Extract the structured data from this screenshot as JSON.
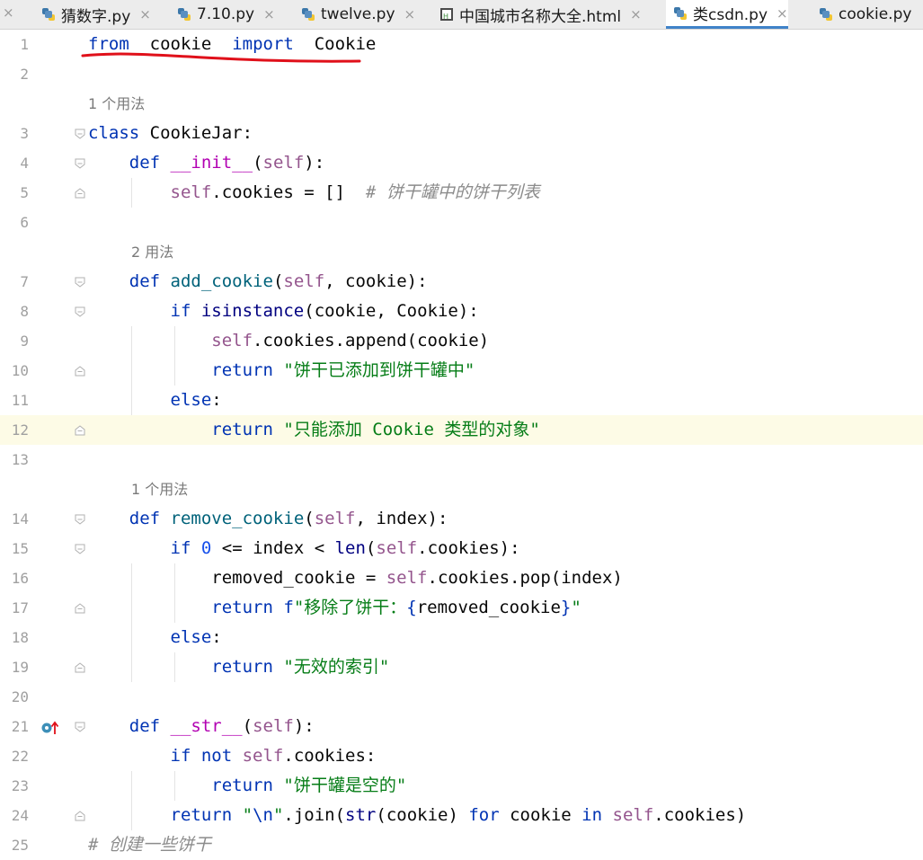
{
  "tabs": [
    {
      "label": "猜数字.py",
      "type": "py",
      "active": false
    },
    {
      "label": "7.10.py",
      "type": "py",
      "active": false
    },
    {
      "label": "twelve.py",
      "type": "py",
      "active": false
    },
    {
      "label": "中国城市名称大全.html",
      "type": "html",
      "active": false
    },
    {
      "label": "类csdn.py",
      "type": "py",
      "active": true
    },
    {
      "label": "cookie.py",
      "type": "py",
      "active": false
    }
  ],
  "close_glyph": "×",
  "usage_hints": {
    "h1": "1 个用法",
    "h2": "2 用法",
    "h3": "1 个用法"
  },
  "lines": [
    {
      "n": "1",
      "tokens": [
        [
          "kw",
          "from"
        ],
        [
          "",
          "  "
        ],
        [
          "",
          "cookie"
        ],
        [
          "",
          "  "
        ],
        [
          "kw",
          "import"
        ],
        [
          "",
          "  "
        ],
        [
          "",
          "Cookie"
        ]
      ]
    },
    {
      "n": "2",
      "tokens": []
    },
    {
      "n": "3",
      "tokens": [
        [
          "kw",
          "class"
        ],
        [
          "",
          " CookieJar:"
        ]
      ]
    },
    {
      "n": "4",
      "tokens": [
        [
          "",
          "    "
        ],
        [
          "kw",
          "def"
        ],
        [
          "",
          " "
        ],
        [
          "dunder",
          "__init__"
        ],
        [
          "",
          "("
        ],
        [
          "self",
          "self"
        ],
        [
          "",
          "):"
        ]
      ]
    },
    {
      "n": "5",
      "tokens": [
        [
          "",
          "        "
        ],
        [
          "self",
          "self"
        ],
        [
          "",
          ".cookies = []  "
        ],
        [
          "cmt",
          "# 饼干罐中的饼干列表"
        ]
      ]
    },
    {
      "n": "6",
      "tokens": []
    },
    {
      "n": "7",
      "tokens": [
        [
          "",
          "    "
        ],
        [
          "kw",
          "def"
        ],
        [
          "",
          " "
        ],
        [
          "fn",
          "add_cookie"
        ],
        [
          "",
          "("
        ],
        [
          "self",
          "self"
        ],
        [
          "",
          ", cookie):"
        ]
      ]
    },
    {
      "n": "8",
      "tokens": [
        [
          "",
          "        "
        ],
        [
          "kw",
          "if"
        ],
        [
          "",
          " "
        ],
        [
          "blt",
          "isinstance"
        ],
        [
          "",
          "(cookie, Cookie):"
        ]
      ]
    },
    {
      "n": "9",
      "tokens": [
        [
          "",
          "            "
        ],
        [
          "self",
          "self"
        ],
        [
          "",
          ".cookies.append(cookie)"
        ]
      ]
    },
    {
      "n": "10",
      "tokens": [
        [
          "",
          "            "
        ],
        [
          "kw",
          "return"
        ],
        [
          "",
          " "
        ],
        [
          "str",
          "\"饼干已添加到饼干罐中\""
        ]
      ]
    },
    {
      "n": "11",
      "tokens": [
        [
          "",
          "        "
        ],
        [
          "kw",
          "else"
        ],
        [
          "",
          ":"
        ]
      ]
    },
    {
      "n": "12",
      "tokens": [
        [
          "",
          "            "
        ],
        [
          "kw",
          "return"
        ],
        [
          "",
          " "
        ],
        [
          "str",
          "\"只能添加 Cookie 类型的对象\""
        ]
      ]
    },
    {
      "n": "13",
      "tokens": []
    },
    {
      "n": "14",
      "tokens": [
        [
          "",
          "    "
        ],
        [
          "kw",
          "def"
        ],
        [
          "",
          " "
        ],
        [
          "fn",
          "remove_cookie"
        ],
        [
          "",
          "("
        ],
        [
          "self",
          "self"
        ],
        [
          "",
          ", index):"
        ]
      ]
    },
    {
      "n": "15",
      "tokens": [
        [
          "",
          "        "
        ],
        [
          "kw",
          "if"
        ],
        [
          "",
          " "
        ],
        [
          "num",
          "0"
        ],
        [
          "",
          " <= index < "
        ],
        [
          "blt",
          "len"
        ],
        [
          "",
          "("
        ],
        [
          "self",
          "self"
        ],
        [
          "",
          ".cookies):"
        ]
      ]
    },
    {
      "n": "16",
      "tokens": [
        [
          "",
          "            removed_cookie = "
        ],
        [
          "self",
          "self"
        ],
        [
          "",
          ".cookies.pop(index)"
        ]
      ]
    },
    {
      "n": "17",
      "tokens": [
        [
          "",
          "            "
        ],
        [
          "kw",
          "return"
        ],
        [
          "",
          " "
        ],
        [
          "kw",
          "f"
        ],
        [
          "str",
          "\"移除了饼干："
        ],
        [
          "kw",
          "{"
        ],
        [
          "",
          "removed_cookie"
        ],
        [
          "kw",
          "}"
        ],
        [
          "str",
          "\""
        ]
      ]
    },
    {
      "n": "18",
      "tokens": [
        [
          "",
          "        "
        ],
        [
          "kw",
          "else"
        ],
        [
          "",
          ":"
        ]
      ]
    },
    {
      "n": "19",
      "tokens": [
        [
          "",
          "            "
        ],
        [
          "kw",
          "return"
        ],
        [
          "",
          " "
        ],
        [
          "str",
          "\"无效的索引\""
        ]
      ]
    },
    {
      "n": "20",
      "tokens": []
    },
    {
      "n": "21",
      "tokens": [
        [
          "",
          "    "
        ],
        [
          "kw",
          "def"
        ],
        [
          "",
          " "
        ],
        [
          "dunder",
          "__str__"
        ],
        [
          "",
          "("
        ],
        [
          "self",
          "self"
        ],
        [
          "",
          "):"
        ]
      ]
    },
    {
      "n": "22",
      "tokens": [
        [
          "",
          "        "
        ],
        [
          "kw",
          "if not"
        ],
        [
          "",
          " "
        ],
        [
          "self",
          "self"
        ],
        [
          "",
          ".cookies:"
        ]
      ]
    },
    {
      "n": "23",
      "tokens": [
        [
          "",
          "            "
        ],
        [
          "kw",
          "return"
        ],
        [
          "",
          " "
        ],
        [
          "str",
          "\"饼干罐是空的\""
        ]
      ]
    },
    {
      "n": "24",
      "tokens": [
        [
          "",
          "        "
        ],
        [
          "kw",
          "return"
        ],
        [
          "",
          " "
        ],
        [
          "str",
          "\""
        ],
        [
          "kw",
          "\\n"
        ],
        [
          "str",
          "\""
        ],
        [
          "",
          ".join("
        ],
        [
          "blt",
          "str"
        ],
        [
          "",
          "(cookie) "
        ],
        [
          "kw",
          "for"
        ],
        [
          "",
          " cookie "
        ],
        [
          "kw",
          "in"
        ],
        [
          "",
          " "
        ],
        [
          "self",
          "self"
        ],
        [
          "",
          ".cookies)"
        ]
      ]
    },
    {
      "n": "25",
      "tokens": [
        [
          "cmt",
          "# 创建一些饼干"
        ]
      ]
    }
  ],
  "colors": {
    "accent": "#4083c9",
    "annotation_red": "#e0101a",
    "current_line": "#fdfbe6"
  }
}
